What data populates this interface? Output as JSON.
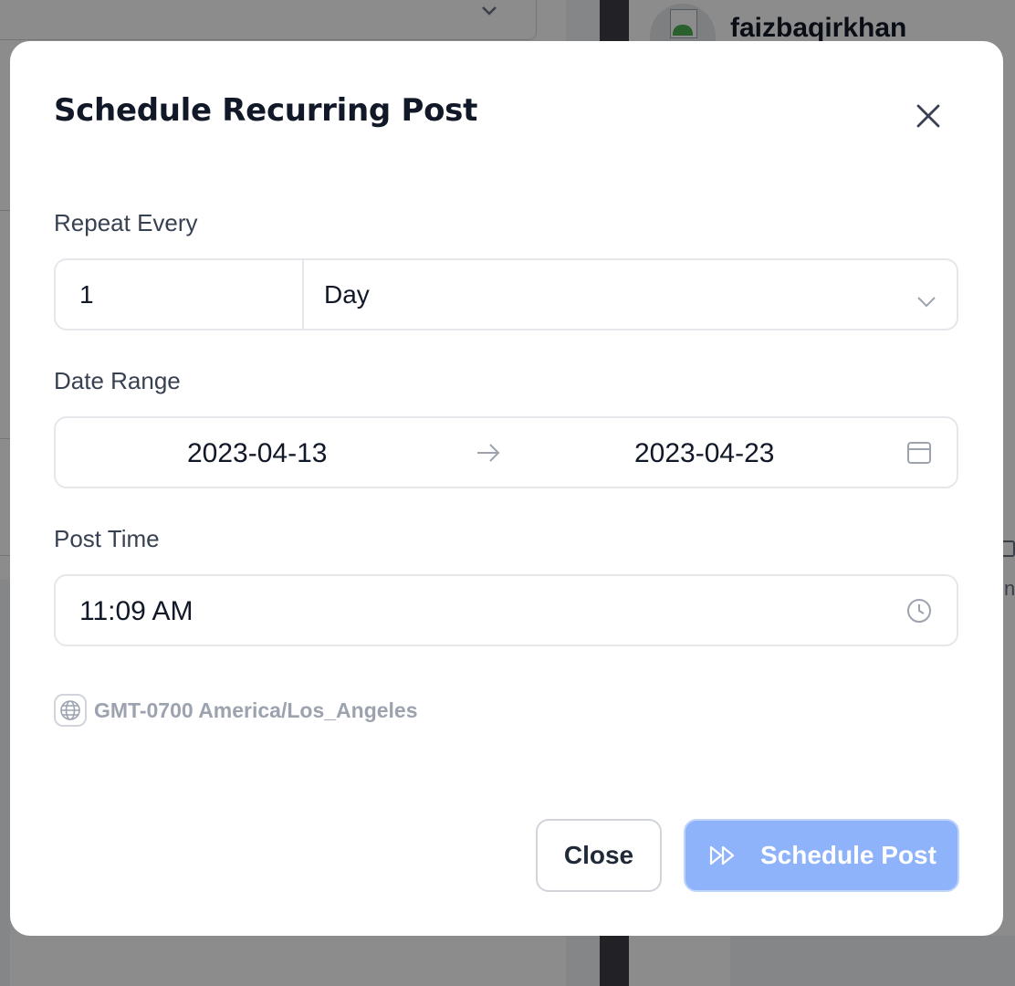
{
  "background": {
    "username": "faizbaqirkhan",
    "partial_char": "n"
  },
  "modal": {
    "title": "Schedule Recurring Post",
    "repeat": {
      "label": "Repeat Every",
      "count": "1",
      "unit": "Day"
    },
    "date_range": {
      "label": "Date Range",
      "start": "2023-04-13",
      "end": "2023-04-23"
    },
    "post_time": {
      "label": "Post Time",
      "value": "11:09 AM"
    },
    "timezone": "GMT-0700 America/Los_Angeles",
    "buttons": {
      "close": "Close",
      "schedule": "Schedule Post"
    }
  },
  "colors": {
    "primary_button": "#8fb3fb",
    "title_text": "#111827",
    "muted_text": "#9ca3af"
  },
  "icons": [
    "close-icon",
    "chevron-down-icon",
    "arrow-right-icon",
    "calendar-icon",
    "clock-icon",
    "globe-icon",
    "fast-forward-icon"
  ]
}
